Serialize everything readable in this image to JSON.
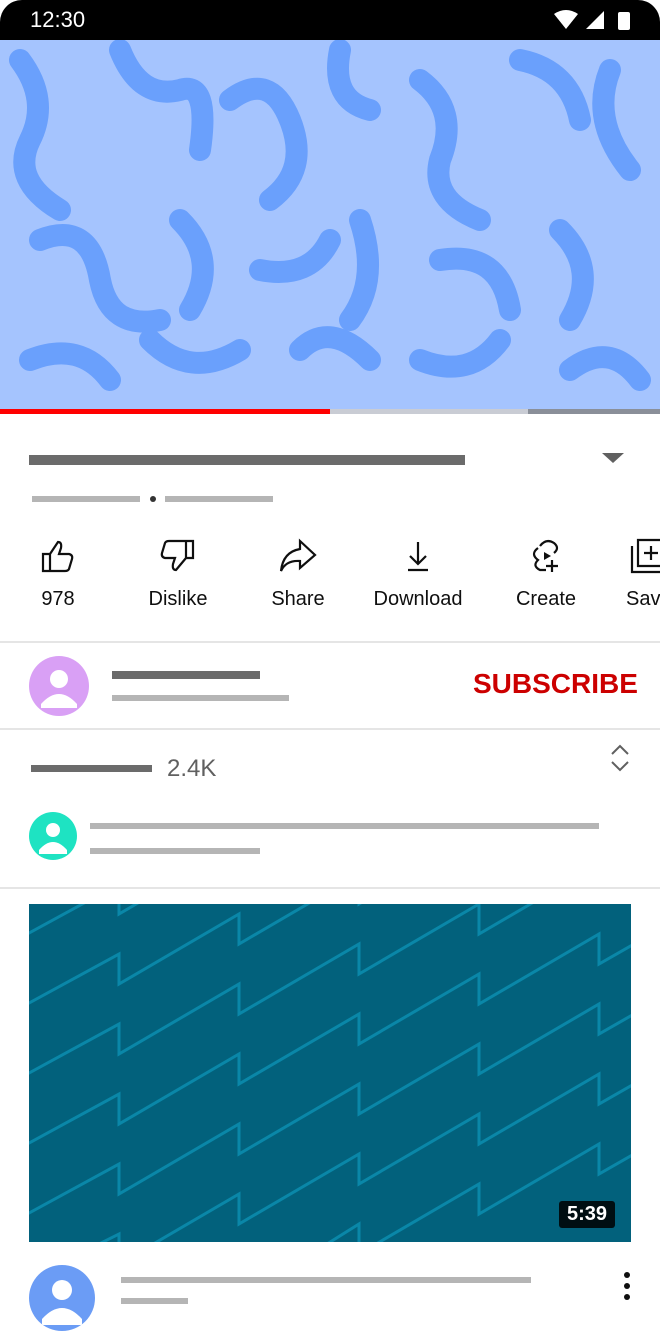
{
  "status_bar": {
    "time": "12:30"
  },
  "player": {
    "progress_percent": 50,
    "buffered_percent": 80,
    "colors": {
      "played": "#ff0000",
      "buffered": "#c9ccd4",
      "remaining": "#8a8f99"
    }
  },
  "actions": [
    {
      "icon": "thumbs-up-icon",
      "label": "978"
    },
    {
      "icon": "thumbs-down-icon",
      "label": "Dislike"
    },
    {
      "icon": "share-icon",
      "label": "Share"
    },
    {
      "icon": "download-icon",
      "label": "Download"
    },
    {
      "icon": "create-icon",
      "label": "Create"
    },
    {
      "icon": "save-playlist-icon",
      "label": "Save"
    }
  ],
  "channel": {
    "subscribe_label": "SUBSCRIBE",
    "subscribe_color": "#cc0000",
    "avatar_color": "#d9a0f5"
  },
  "comments": {
    "count": "2.4K",
    "avatar_color": "#1ee3c2"
  },
  "next_video": {
    "duration": "5:39",
    "avatar_color": "#6b9cf5"
  }
}
